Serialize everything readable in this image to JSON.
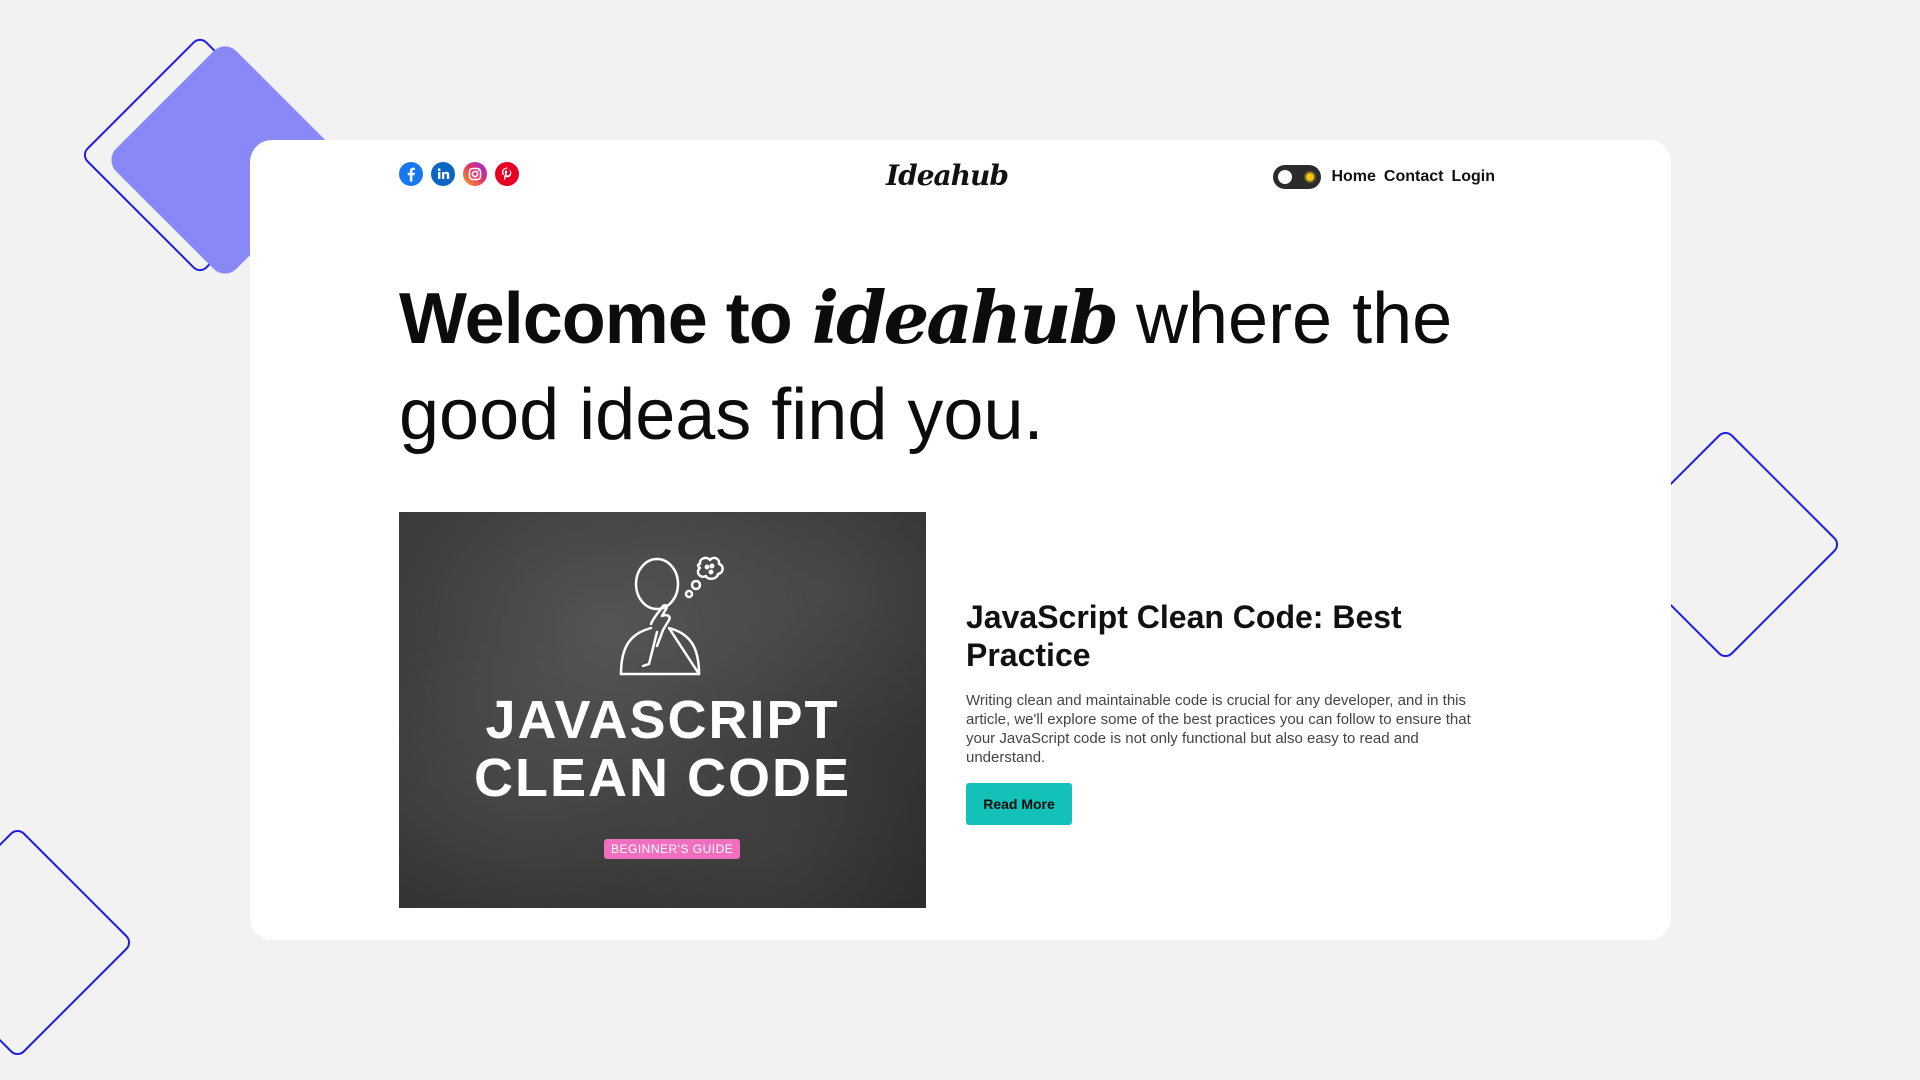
{
  "header": {
    "logo": "Ideahub",
    "socials": [
      {
        "name": "facebook-icon",
        "color": "#1877f2"
      },
      {
        "name": "linkedin-icon",
        "color": "#0a66c2"
      },
      {
        "name": "instagram-icon",
        "color": "#e1306c"
      },
      {
        "name": "pinterest-icon",
        "color": "#e60023"
      }
    ],
    "theme_toggle": {
      "state": "light",
      "icon": "sun-icon"
    },
    "nav": {
      "home": "Home",
      "contact": "Contact",
      "login": "Login"
    }
  },
  "hero": {
    "prefix": "Welcome to",
    "brand": "ideahub",
    "suffix": "where the good ideas find you."
  },
  "article": {
    "image": {
      "line1": "JAVASCRIPT",
      "line2": "CLEAN CODE",
      "badge": "BEGINNER'S GUIDE",
      "illustration": "thinking-person-icon"
    },
    "title": "JavaScript Clean Code: Best Practice",
    "excerpt": "Writing clean and maintainable code is crucial for any developer, and in this article, we'll explore some of the best practices you can follow to ensure that your JavaScript code is not only functional but also easy to read and understand.",
    "cta": "Read More"
  },
  "colors": {
    "background": "#f2f2f2",
    "card": "#ffffff",
    "accent_purple": "#8888f7",
    "outline_blue": "#1f1fe0",
    "cta_teal": "#14c1b9",
    "badge_pink": "#f06fbf"
  }
}
